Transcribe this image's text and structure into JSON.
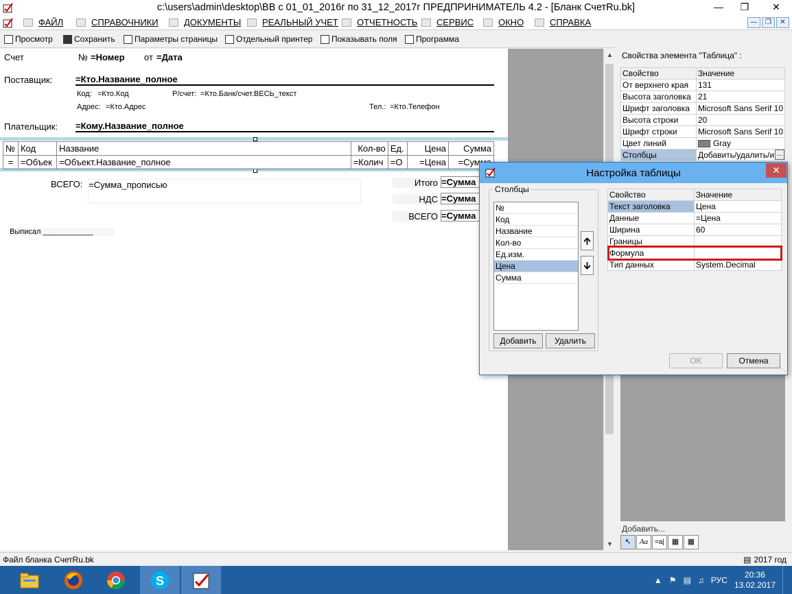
{
  "window": {
    "title": "c:\\users\\admin\\desktop\\ВВ с 01_01_2016г по 31_12_2017г  ПРЕДПРИНИМАТЕЛЬ 4.2 - [Бланк  СчетRu.bk]"
  },
  "menu": {
    "items": [
      {
        "label": "ФАЙЛ"
      },
      {
        "label": "СПРАВОЧНИКИ"
      },
      {
        "label": "ДОКУМЕНТЫ"
      },
      {
        "label": "РЕАЛЬНЫЙ УЧЕТ"
      },
      {
        "label": "ОТЧЕТНОСТЬ"
      },
      {
        "label": "СЕРВИС"
      },
      {
        "label": "ОКНО"
      },
      {
        "label": "СПРАВКА"
      }
    ]
  },
  "toolbar": {
    "preview": "Просмотр",
    "save": "Сохранить",
    "page_params": "Параметры страницы",
    "separate_printer": "Отдельный принтер",
    "show_fields": "Показывать поля",
    "program": "Программа"
  },
  "document": {
    "invoice_label": "Счет",
    "number_prefix": "№",
    "number_value": "=Номер",
    "date_prefix": "от",
    "date_value": "=Дата",
    "supplier_label": "Поставщик:",
    "supplier_value": "=Кто.Название_полное",
    "code_label": "Код:",
    "code_value": "=Кто.Код",
    "account_label": "Р/счет:",
    "account_value": "=Кто.Банк/счет.ВЕСЬ_текст",
    "address_label": "Адрес:",
    "address_value": "=Кто.Адрес",
    "phone_label": "Тел.:",
    "phone_value": "=Кто.Телефон",
    "payer_label": "Плательщик:",
    "payer_value": "=Кому.Название_полное",
    "table": {
      "headers": [
        "№",
        "Код",
        "Название",
        "Кол-во",
        "Ед.",
        "Цена",
        "Сумма"
      ],
      "row": [
        "=",
        "=Объек",
        "=Объект.Название_полное",
        "=Колич",
        "=О",
        "=Цена",
        "=Сумма"
      ]
    },
    "total_words_label": "ВСЕГО:",
    "total_words_value": "=Сумма_прописью",
    "itogo_label": "Итого",
    "itogo_value": "=Сумма",
    "nds_label": "НДС",
    "nds_value": "=Сумма",
    "vsego_label": "ВСЕГО",
    "vsego_value": "=Сумма",
    "signed_label": "Выписал",
    "signed_line": "____________"
  },
  "properties": {
    "title": "Свойства элемента \"Таблица\" :",
    "col_property": "Свойство",
    "col_value": "Значение",
    "rows": [
      {
        "name": "От верхнего края",
        "value": "131"
      },
      {
        "name": "Высота заголовка",
        "value": "21"
      },
      {
        "name": "Шрифт заголовка",
        "value": "Microsoft Sans Serif 10"
      },
      {
        "name": "Высота строки",
        "value": "20"
      },
      {
        "name": "Шрифт строки",
        "value": "Microsoft Sans Serif 10"
      },
      {
        "name": "Цвет линий",
        "value": "Gray"
      },
      {
        "name": "Столбцы",
        "value": "Добавить/удалить/и"
      }
    ],
    "line_color": "#808080",
    "add_label": "Добавить...",
    "tools": [
      "pointer",
      "Aa",
      "=a|",
      "image",
      "table"
    ]
  },
  "dialog": {
    "title": "Настройка таблицы",
    "columns_group": "Столбцы",
    "columns": [
      "№",
      "Код",
      "Название",
      "Кол-во",
      "Ед.изм.",
      "Цена",
      "Сумма"
    ],
    "selected_column": "Цена",
    "add_button": "Добавить",
    "delete_button": "Удалить",
    "col_property": "Свойство",
    "col_value": "Значение",
    "props": [
      {
        "name": "Текст заголовка",
        "value": "Цена"
      },
      {
        "name": "Данные",
        "value": "=Цена"
      },
      {
        "name": "Ширина",
        "value": "60"
      },
      {
        "name": "Границы",
        "value": ""
      },
      {
        "name": "Формула",
        "value": ""
      },
      {
        "name": "Тип данных",
        "value": "System.Decimal"
      }
    ],
    "ok_button": "OK",
    "cancel_button": "Отмена"
  },
  "status": {
    "file": "Файл бланка  СчетRu.bk",
    "year": "2017 год"
  },
  "taskbar": {
    "lang": "РУС",
    "time": "20:36",
    "date": "13.02.2017"
  },
  "colors": {
    "accent": "#6ab1ef",
    "highlight": "#d01818",
    "taskbar": "#1f5fa0",
    "section_bar": "#b5d8e4"
  }
}
